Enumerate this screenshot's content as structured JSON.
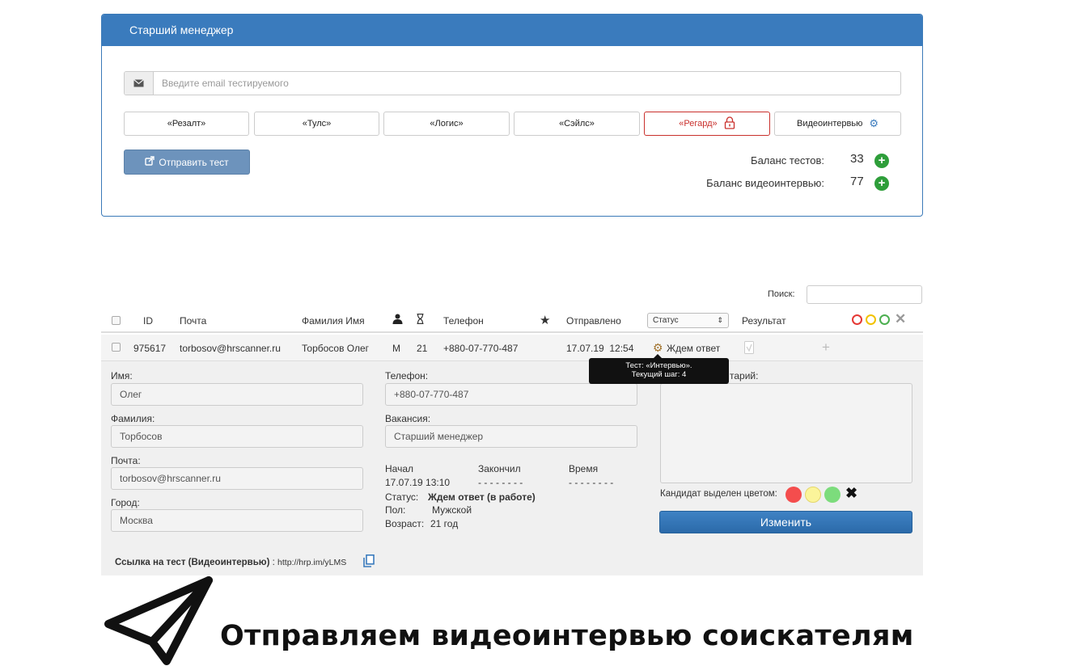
{
  "panel": {
    "title": "Старший менеджер",
    "email_placeholder": "Введите email тестируемого",
    "tests": [
      "«Резалт»",
      "«Тулс»",
      "«Логис»",
      "«Сэйлс»",
      "«Регард»",
      "Видеоинтервью"
    ],
    "send_button": "Отправить тест",
    "balance_tests_label": "Баланс тестов:",
    "balance_tests_value": "33",
    "balance_video_label": "Баланс видеоинтервью:",
    "balance_video_value": "77",
    "accent_color": "#3a7bbd"
  },
  "table": {
    "search_label": "Поиск:",
    "headers": {
      "id": "ID",
      "email": "Почта",
      "name": "Фамилия Имя",
      "phone": "Телефон",
      "sent": "Отправлено",
      "status_select": "Статус",
      "result": "Результат"
    },
    "row": {
      "id": "975617",
      "email": "torbosov@hrscanner.ru",
      "name": "Торбосов Олег",
      "gender": "М",
      "age": "21",
      "phone": "+880-07-770-487",
      "sent": "17.07.19  12:54",
      "status": "Ждем ответ"
    },
    "tooltip_line1": "Тест: «Интервью».",
    "tooltip_line2": "Текущий шаг: 4"
  },
  "details": {
    "name_label": "Имя:",
    "name_value": "Олег",
    "surname_label": "Фамилия:",
    "surname_value": "Торбосов",
    "email_label": "Почта:",
    "email_value": "torbosov@hrscanner.ru",
    "city_label": "Город:",
    "city_value": "Москва",
    "phone_label": "Телефон:",
    "phone_value": "+880-07-770-487",
    "vacancy_label": "Вакансия:",
    "vacancy_value": "Старший менеджер",
    "start_label": "Начал",
    "start_value": "17.07.19 13:10",
    "end_label": "Закончил",
    "end_value": "- - - - - - - -",
    "time_label": "Время",
    "time_value": "- - - - - - - -",
    "status_label": "Статус:",
    "status_value": "Ждем ответ (в работе)",
    "gender_label": "Пол:",
    "gender_value": "Мужской",
    "age_label": "Возраст:",
    "age_value": "21 год",
    "comment_label": "тарий:",
    "color_label": "Кандидат выделен цветом:",
    "change_button": "Изменить",
    "link_label": "Ссылка на тест (Видеоинтервью)",
    "link_sep": " : ",
    "link_url": "http://hrp.im/yLMS"
  },
  "banner": {
    "text": "Отправляем видеоинтервью соискателям"
  }
}
